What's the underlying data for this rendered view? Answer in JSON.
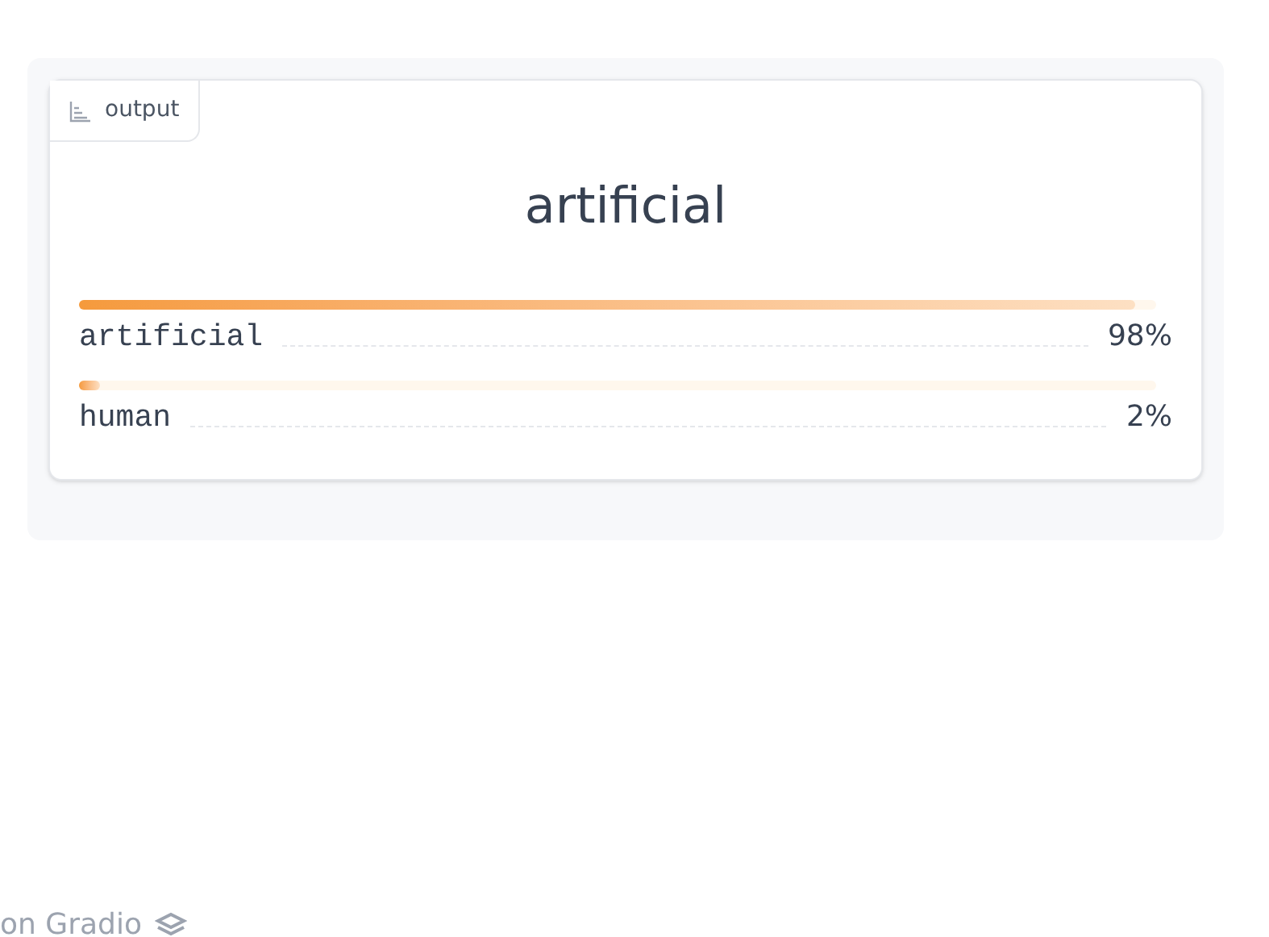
{
  "output": {
    "label": "output",
    "title": "artificial",
    "confidences": [
      {
        "label": "artificial",
        "level": 0.98,
        "reading": "98%"
      },
      {
        "label": "human",
        "level": 0.02,
        "reading": "2%"
      }
    ]
  },
  "footer": {
    "text": "on Gradio"
  }
}
